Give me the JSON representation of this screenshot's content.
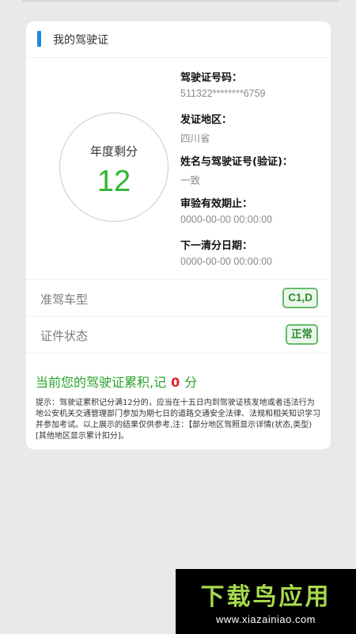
{
  "header": {
    "title": "我的驾驶证"
  },
  "score": {
    "label": "年度剩分",
    "value": "12"
  },
  "info": [
    {
      "label": "驾驶证号码：",
      "value": "511322********6759"
    },
    {
      "label": "发证地区：",
      "value": "四川省"
    },
    {
      "label": "姓名与驾驶证号(验证)：",
      "value": "一致"
    },
    {
      "label": "审验有效期止：",
      "value": "0000-00-00 00:00:00"
    },
    {
      "label": "下一清分日期：",
      "value": "0000-00-00 00:00:00"
    }
  ],
  "vehicle_type": {
    "label": "准驾车型",
    "value": "C1,D"
  },
  "license_status": {
    "label": "证件状态",
    "value": "正常"
  },
  "points": {
    "prefix": "当前您的驾驶证累积,记",
    "value": "0",
    "suffix": "分"
  },
  "notice": "提示：驾驶证累积记分满12分的，应当在十五日内到驾驶证核发地或者违法行为地公安机关交通管理部门参加为期七日的道路交通安全法律、法规和相关知识学习并参加考试。以上展示的结果仅供参考,注：【部分地区驾照显示详情(状态,类型)[其他地区显示累计扣分]。",
  "watermark": {
    "title": "下载鸟应用",
    "url": "www.xiazainiao.com"
  },
  "colors": {
    "accent_blue": "#1e88e5",
    "score_green": "#2fb52f",
    "points_red": "#e02424",
    "badge_green": "#66bb6a"
  }
}
